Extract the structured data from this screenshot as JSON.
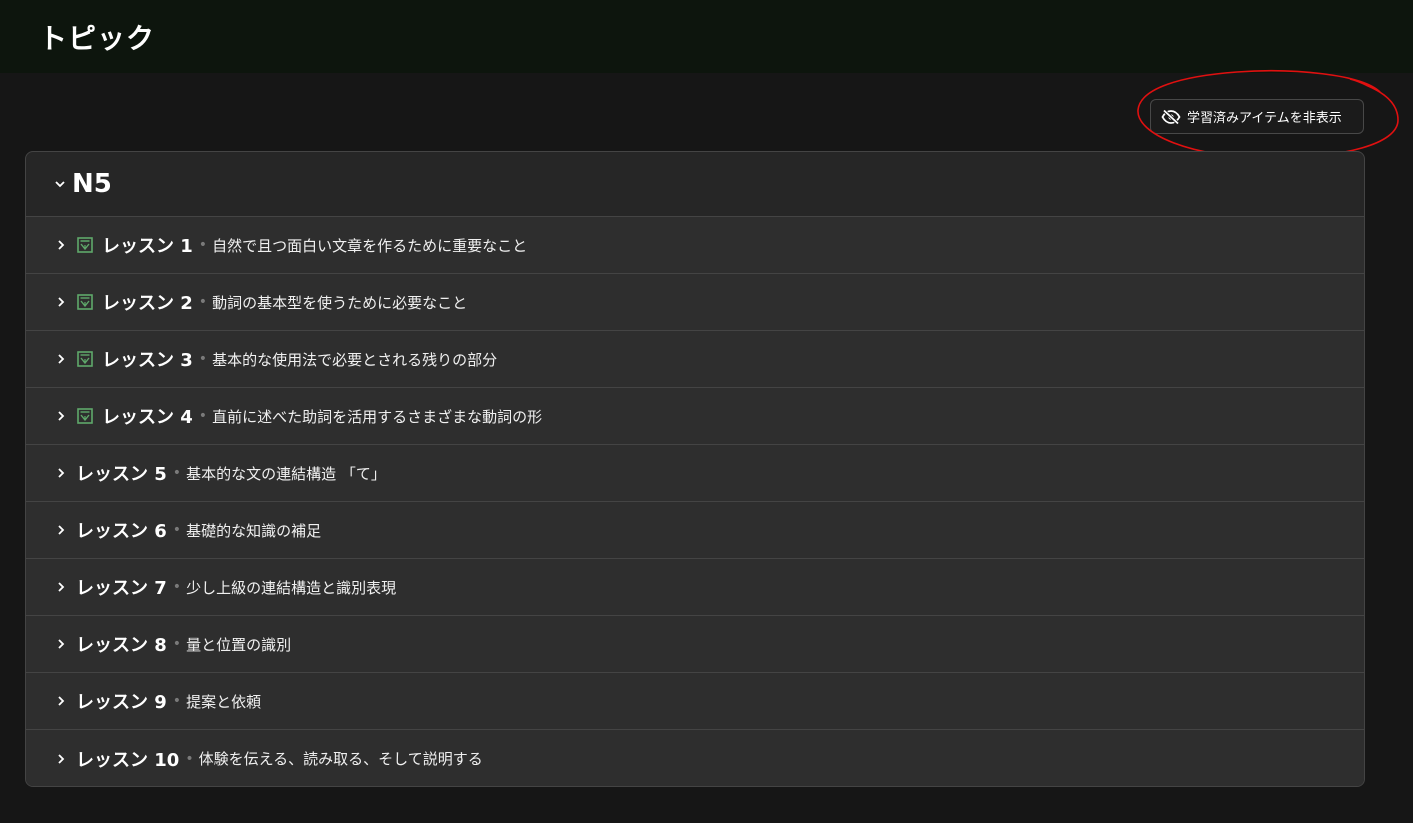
{
  "header": {
    "title": "トピック"
  },
  "toolbar": {
    "hide_learned_label": "学習済みアイテムを非表示"
  },
  "section": {
    "level": "N5",
    "lessons": [
      {
        "name": "レッスン 1",
        "desc": "自然で且つ面白い文章を作るために重要なこと",
        "completed": true
      },
      {
        "name": "レッスン 2",
        "desc": "動詞の基本型を使うために必要なこと",
        "completed": true
      },
      {
        "name": "レッスン 3",
        "desc": "基本的な使用法で必要とされる残りの部分",
        "completed": true
      },
      {
        "name": "レッスン 4",
        "desc": "直前に述べた助詞を活用するさまざまな動詞の形",
        "completed": true
      },
      {
        "name": "レッスン 5",
        "desc": "基本的な文の連結構造 「て」",
        "completed": false
      },
      {
        "name": "レッスン 6",
        "desc": "基礎的な知識の補足",
        "completed": false
      },
      {
        "name": "レッスン 7",
        "desc": "少し上級の連結構造と識別表現",
        "completed": false
      },
      {
        "name": "レッスン 8",
        "desc": "量と位置の識別",
        "completed": false
      },
      {
        "name": "レッスン 9",
        "desc": "提案と依頼",
        "completed": false
      },
      {
        "name": "レッスン 10",
        "desc": "体験を伝える、読み取る、そして説明する",
        "completed": false
      }
    ]
  },
  "colors": {
    "completed_icon": "#5fa86a",
    "annotation": "#e01010",
    "topbar": "#0d150d"
  },
  "icons": {
    "hide_button": "eye-off-icon",
    "section_toggle": "chevron-down-icon",
    "row_toggle": "chevron-right-icon",
    "completed": "check-square-icon"
  }
}
